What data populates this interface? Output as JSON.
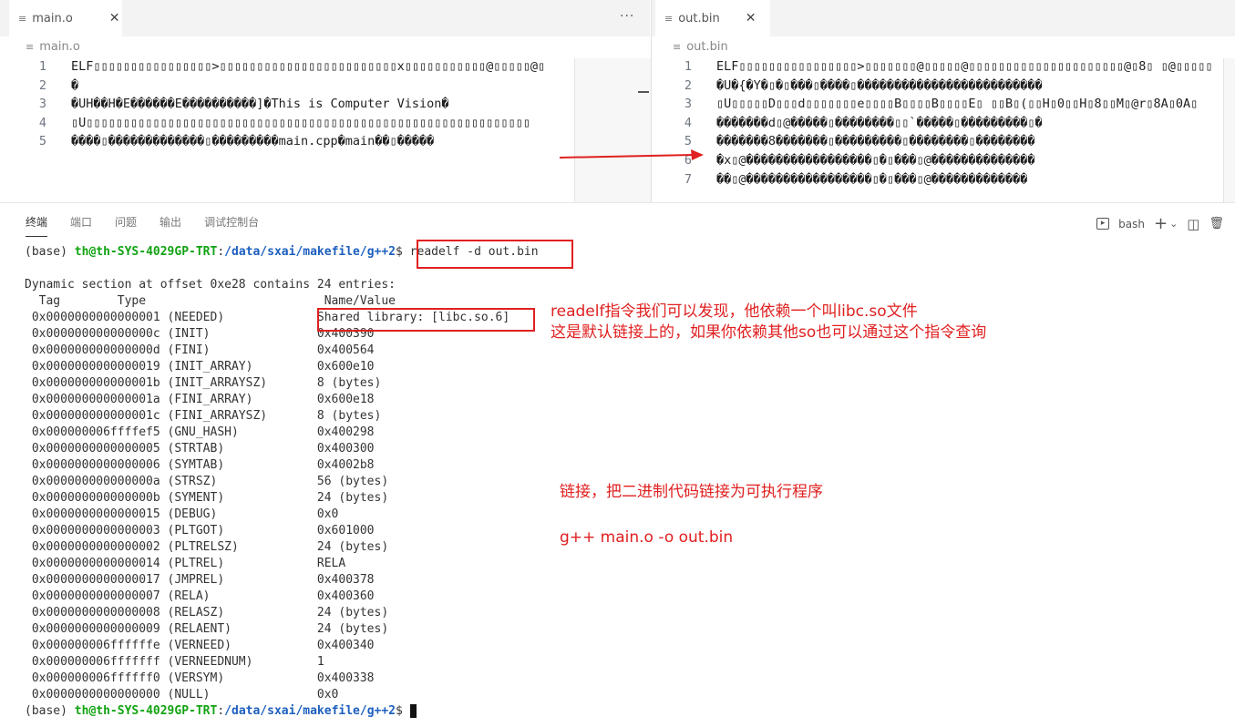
{
  "left_editor": {
    "tab_label": "main.o",
    "breadcrumb": "main.o",
    "more_label": "···",
    "close_label": "✕",
    "file_icon": "≡",
    "lines": [
      {
        "num": "1",
        "text": " ELF▯▯▯▯▯▯▯▯▯▯▯▯▯▯▯▯>▯▯▯▯▯▯▯▯▯▯▯▯▯▯▯▯▯▯▯▯▯▯▯▯x▯▯▯▯▯▯▯▯▯▯▯@▯▯▯▯▯@▯"
      },
      {
        "num": "2",
        "text": "�"
      },
      {
        "num": "3",
        "text": "�UH��H�E������E����������]�This is Computer Vision�"
      },
      {
        "num": "4",
        "text": "▯U▯▯▯▯▯▯▯▯▯▯▯▯▯▯▯▯▯▯▯▯▯▯▯▯▯▯▯▯▯▯▯▯▯▯▯▯▯▯▯▯▯▯▯▯▯▯▯▯▯▯▯▯▯▯▯▯▯▯▯▯"
      },
      {
        "num": "5",
        "text": "����▯�������������▯���������main.cpp�main��▯�����"
      }
    ]
  },
  "right_editor": {
    "tab_label": "out.bin",
    "breadcrumb": "out.bin",
    "close_label": "✕",
    "file_icon": "≡",
    "lines": [
      {
        "num": "1",
        "text": " ELF▯▯▯▯▯▯▯▯▯▯▯▯▯▯▯▯>▯▯▯▯▯▯▯@▯▯▯▯▯@▯▯▯▯▯▯▯▯▯▯▯▯▯▯▯▯▯▯▯▯▯@▯8▯    ▯@▯▯▯▯▯"
      },
      {
        "num": "2",
        "text": "�U�{�Y�▯�▯���▯����▯�������������������������"
      },
      {
        "num": "3",
        "text": "▯U▯▯▯▯▯D▯▯▯d▯▯▯▯▯▯▯e▯▯▯▯B▯▯▯▯B▯▯▯▯E▯ ▯▯B▯(▯▯H▯0▯▯H▯8▯▯M▯@r▯8A▯0A▯"
      },
      {
        "num": "4",
        "text": "�������d▯@�����▯��������▯▯`�����▯���������▯�"
      },
      {
        "num": "5",
        "text": "�������8�������▯���������▯��������▯��������"
      },
      {
        "num": "6",
        "text": "�x▯@�����������������▯�▯���▯@��������������"
      },
      {
        "num": "7",
        "text": "��▯@�����������������▯�▯���▯@�������������"
      }
    ]
  },
  "panel": {
    "tabs": [
      "终端",
      "端口",
      "问题",
      "输出",
      "调试控制台"
    ],
    "shell_label": "bash",
    "plus": "+",
    "chevron": "⌄",
    "split_icon": "◫",
    "trash_icon": "🗑",
    "terminal_icon": "▸"
  },
  "terminal": {
    "prompt_prefix": "(base) ",
    "user_host": "th@th-SYS-4029GP-TRT",
    "path": "/data/sxai/makefile/g++2",
    "dollar": "$ ",
    "command": "readelf -d out.bin",
    "header": "Dynamic section at offset 0xe28 contains 24 entries:",
    "col_header": "  Tag        Type                         Name/Value",
    "entries": [
      " 0x0000000000000001 (NEEDED)             Shared library: [libc.so.6]",
      " 0x000000000000000c (INIT)               0x400390",
      " 0x000000000000000d (FINI)               0x400564",
      " 0x0000000000000019 (INIT_ARRAY)         0x600e10",
      " 0x000000000000001b (INIT_ARRAYSZ)       8 (bytes)",
      " 0x000000000000001a (FINI_ARRAY)         0x600e18",
      " 0x000000000000001c (FINI_ARRAYSZ)       8 (bytes)",
      " 0x000000006ffffef5 (GNU_HASH)           0x400298",
      " 0x0000000000000005 (STRTAB)             0x400300",
      " 0x0000000000000006 (SYMTAB)             0x4002b8",
      " 0x000000000000000a (STRSZ)              56 (bytes)",
      " 0x000000000000000b (SYMENT)             24 (bytes)",
      " 0x0000000000000015 (DEBUG)              0x0",
      " 0x0000000000000003 (PLTGOT)             0x601000",
      " 0x0000000000000002 (PLTRELSZ)           24 (bytes)",
      " 0x0000000000000014 (PLTREL)             RELA",
      " 0x0000000000000017 (JMPREL)             0x400378",
      " 0x0000000000000007 (RELA)               0x400360",
      " 0x0000000000000008 (RELASZ)             24 (bytes)",
      " 0x0000000000000009 (RELAENT)            24 (bytes)",
      " 0x000000006ffffffe (VERNEED)            0x400340",
      " 0x000000006fffffff (VERNEEDNUM)         1",
      " 0x000000006ffffff0 (VERSYM)             0x400338",
      " 0x0000000000000000 (NULL)               0x0"
    ]
  },
  "annotations": {
    "note1_line1": "readelf指令我们可以发现，他依赖一个叫libc.so文件",
    "note1_line2": "这是默认链接上的，如果你依赖其他so也可以通过这个指令查询",
    "note2": "链接，把二进制代码链接为可执行程序",
    "note3": "g++ main.o -o out.bin",
    "color": "#e02020"
  }
}
